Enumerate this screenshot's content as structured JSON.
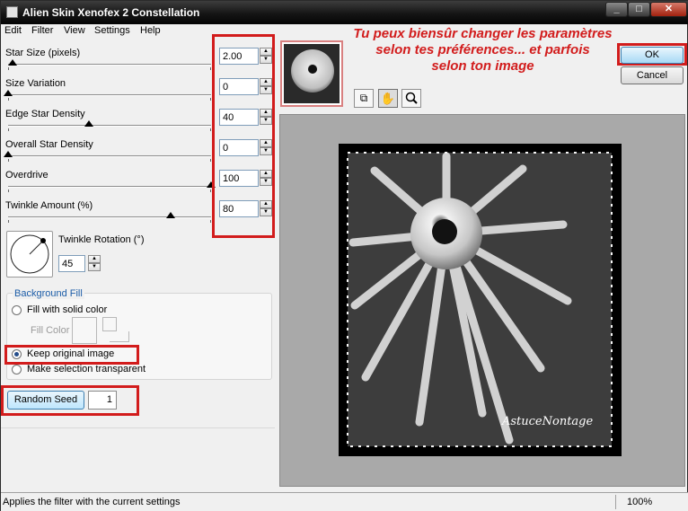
{
  "window": {
    "title": "Alien Skin Xenofex 2 Constellation"
  },
  "menu": [
    "Edit",
    "Filter",
    "View",
    "Settings",
    "Help"
  ],
  "params": [
    {
      "label": "Star Size (pixels)",
      "value": "2.00",
      "slider_fraction": 0.02
    },
    {
      "label": "Size Variation",
      "value": "0",
      "slider_fraction": 0.0
    },
    {
      "label": "Edge Star Density",
      "value": "40",
      "slider_fraction": 0.4
    },
    {
      "label": "Overall Star Density",
      "value": "0",
      "slider_fraction": 0.0
    },
    {
      "label": "Overdrive",
      "value": "100",
      "slider_fraction": 1.0
    },
    {
      "label": "Twinkle Amount (%)",
      "value": "80",
      "slider_fraction": 0.8
    }
  ],
  "twinkle_rotation": {
    "label": "Twinkle Rotation (°)",
    "value": "45"
  },
  "background_fill": {
    "title": "Background Fill",
    "options": [
      "Fill with solid color",
      "Keep original image",
      "Make selection transparent"
    ],
    "selected": "Keep original image",
    "fill_color_label": "Fill Color"
  },
  "random_seed": {
    "button_label": "Random Seed",
    "value": "1"
  },
  "annotation": {
    "lines": [
      "Tu peux biensûr changer les paramètres",
      "selon tes préférences... et parfois",
      "selon ton image"
    ],
    "color": "#d21c1c"
  },
  "buttons": {
    "ok": "OK",
    "cancel": "Cancel"
  },
  "preview": {
    "watermark": "AstuceNontage"
  },
  "status": {
    "text": "Applies the filter with the current settings",
    "zoom": "100%"
  },
  "colors": {
    "accent": "#d21c1c",
    "selection": "#3a78d4",
    "preview_bg": "#a9a9a9"
  }
}
